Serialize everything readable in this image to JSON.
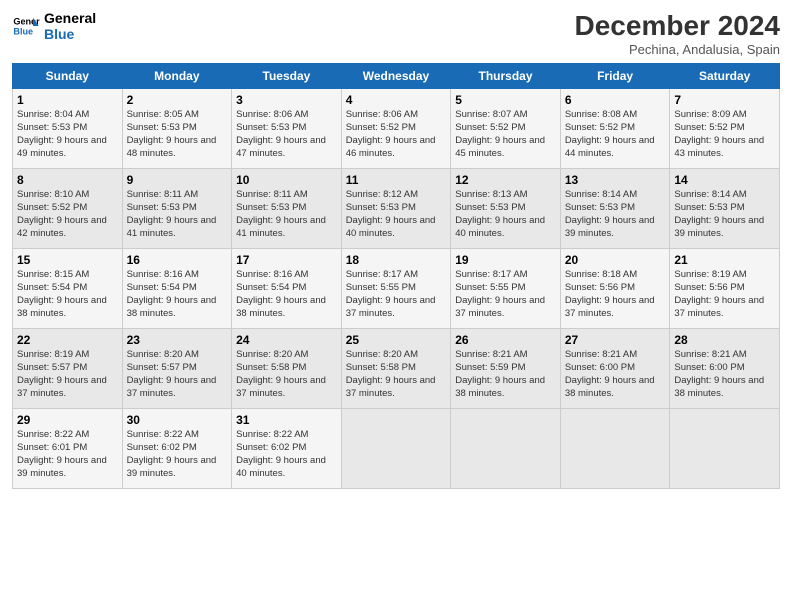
{
  "header": {
    "logo_line1": "General",
    "logo_line2": "Blue",
    "month": "December 2024",
    "location": "Pechina, Andalusia, Spain"
  },
  "days_of_week": [
    "Sunday",
    "Monday",
    "Tuesday",
    "Wednesday",
    "Thursday",
    "Friday",
    "Saturday"
  ],
  "weeks": [
    [
      {
        "day": "1",
        "sunrise": "8:04 AM",
        "sunset": "5:53 PM",
        "daylight": "9 hours and 49 minutes."
      },
      {
        "day": "2",
        "sunrise": "8:05 AM",
        "sunset": "5:53 PM",
        "daylight": "9 hours and 48 minutes."
      },
      {
        "day": "3",
        "sunrise": "8:06 AM",
        "sunset": "5:53 PM",
        "daylight": "9 hours and 47 minutes."
      },
      {
        "day": "4",
        "sunrise": "8:06 AM",
        "sunset": "5:52 PM",
        "daylight": "9 hours and 46 minutes."
      },
      {
        "day": "5",
        "sunrise": "8:07 AM",
        "sunset": "5:52 PM",
        "daylight": "9 hours and 45 minutes."
      },
      {
        "day": "6",
        "sunrise": "8:08 AM",
        "sunset": "5:52 PM",
        "daylight": "9 hours and 44 minutes."
      },
      {
        "day": "7",
        "sunrise": "8:09 AM",
        "sunset": "5:52 PM",
        "daylight": "9 hours and 43 minutes."
      }
    ],
    [
      {
        "day": "8",
        "sunrise": "8:10 AM",
        "sunset": "5:52 PM",
        "daylight": "9 hours and 42 minutes."
      },
      {
        "day": "9",
        "sunrise": "8:11 AM",
        "sunset": "5:53 PM",
        "daylight": "9 hours and 41 minutes."
      },
      {
        "day": "10",
        "sunrise": "8:11 AM",
        "sunset": "5:53 PM",
        "daylight": "9 hours and 41 minutes."
      },
      {
        "day": "11",
        "sunrise": "8:12 AM",
        "sunset": "5:53 PM",
        "daylight": "9 hours and 40 minutes."
      },
      {
        "day": "12",
        "sunrise": "8:13 AM",
        "sunset": "5:53 PM",
        "daylight": "9 hours and 40 minutes."
      },
      {
        "day": "13",
        "sunrise": "8:14 AM",
        "sunset": "5:53 PM",
        "daylight": "9 hours and 39 minutes."
      },
      {
        "day": "14",
        "sunrise": "8:14 AM",
        "sunset": "5:53 PM",
        "daylight": "9 hours and 39 minutes."
      }
    ],
    [
      {
        "day": "15",
        "sunrise": "8:15 AM",
        "sunset": "5:54 PM",
        "daylight": "9 hours and 38 minutes."
      },
      {
        "day": "16",
        "sunrise": "8:16 AM",
        "sunset": "5:54 PM",
        "daylight": "9 hours and 38 minutes."
      },
      {
        "day": "17",
        "sunrise": "8:16 AM",
        "sunset": "5:54 PM",
        "daylight": "9 hours and 38 minutes."
      },
      {
        "day": "18",
        "sunrise": "8:17 AM",
        "sunset": "5:55 PM",
        "daylight": "9 hours and 37 minutes."
      },
      {
        "day": "19",
        "sunrise": "8:17 AM",
        "sunset": "5:55 PM",
        "daylight": "9 hours and 37 minutes."
      },
      {
        "day": "20",
        "sunrise": "8:18 AM",
        "sunset": "5:56 PM",
        "daylight": "9 hours and 37 minutes."
      },
      {
        "day": "21",
        "sunrise": "8:19 AM",
        "sunset": "5:56 PM",
        "daylight": "9 hours and 37 minutes."
      }
    ],
    [
      {
        "day": "22",
        "sunrise": "8:19 AM",
        "sunset": "5:57 PM",
        "daylight": "9 hours and 37 minutes."
      },
      {
        "day": "23",
        "sunrise": "8:20 AM",
        "sunset": "5:57 PM",
        "daylight": "9 hours and 37 minutes."
      },
      {
        "day": "24",
        "sunrise": "8:20 AM",
        "sunset": "5:58 PM",
        "daylight": "9 hours and 37 minutes."
      },
      {
        "day": "25",
        "sunrise": "8:20 AM",
        "sunset": "5:58 PM",
        "daylight": "9 hours and 37 minutes."
      },
      {
        "day": "26",
        "sunrise": "8:21 AM",
        "sunset": "5:59 PM",
        "daylight": "9 hours and 38 minutes."
      },
      {
        "day": "27",
        "sunrise": "8:21 AM",
        "sunset": "6:00 PM",
        "daylight": "9 hours and 38 minutes."
      },
      {
        "day": "28",
        "sunrise": "8:21 AM",
        "sunset": "6:00 PM",
        "daylight": "9 hours and 38 minutes."
      }
    ],
    [
      {
        "day": "29",
        "sunrise": "8:22 AM",
        "sunset": "6:01 PM",
        "daylight": "9 hours and 39 minutes."
      },
      {
        "day": "30",
        "sunrise": "8:22 AM",
        "sunset": "6:02 PM",
        "daylight": "9 hours and 39 minutes."
      },
      {
        "day": "31",
        "sunrise": "8:22 AM",
        "sunset": "6:02 PM",
        "daylight": "9 hours and 40 minutes."
      },
      null,
      null,
      null,
      null
    ]
  ]
}
